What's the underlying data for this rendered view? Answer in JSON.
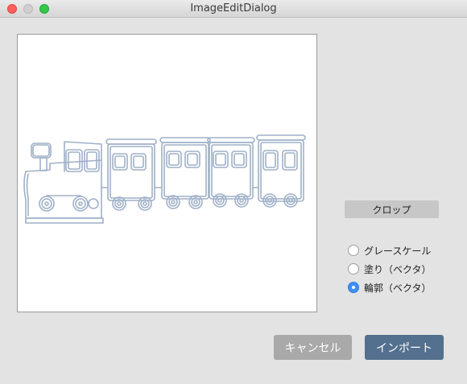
{
  "window": {
    "title": "ImageEditDialog",
    "buttons": [
      "close",
      "minimize",
      "maximize"
    ]
  },
  "canvas": {
    "image_subject": "train-outline-icon"
  },
  "crop": {
    "label": "クロップ"
  },
  "mode": {
    "options": [
      {
        "label": "グレースケール",
        "checked": false
      },
      {
        "label": "塗り（ベクタ）",
        "checked": false
      },
      {
        "label": "輪郭（ベクタ）",
        "checked": true
      }
    ]
  },
  "actions": {
    "cancel_label": "キャンセル",
    "import_label": "インポート"
  },
  "colors": {
    "accent": "#3f8ff7",
    "import_button": "#53708e",
    "cancel_button": "#a9a9a9",
    "outline_stroke": "#9fb0c7"
  }
}
